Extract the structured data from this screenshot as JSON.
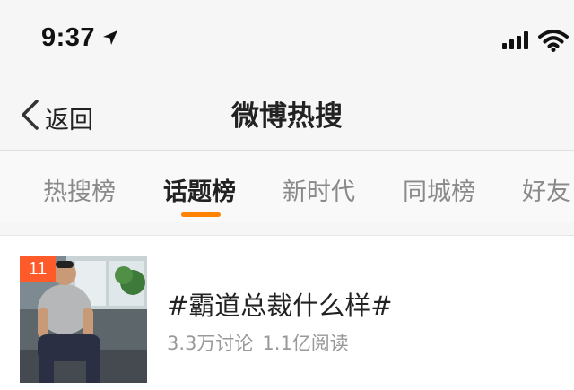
{
  "status_bar": {
    "time": "9:37",
    "icons": [
      "location-arrow-icon",
      "cellular-signal-icon",
      "wifi-icon"
    ]
  },
  "nav": {
    "back_label": "返回",
    "title": "微博热搜"
  },
  "tabs": [
    {
      "label": "热搜榜",
      "active": false
    },
    {
      "label": "话题榜",
      "active": true
    },
    {
      "label": "新时代",
      "active": false
    },
    {
      "label": "同城榜",
      "active": false
    },
    {
      "label": "好友",
      "active": false
    }
  ],
  "colors": {
    "accent": "#ff8200",
    "rank_badge": "#ff5a29"
  },
  "topics": [
    {
      "rank": "11",
      "title": "#霸道总裁什么样#",
      "discussions": "3.3万讨论",
      "reads": "1.1亿阅读"
    }
  ]
}
